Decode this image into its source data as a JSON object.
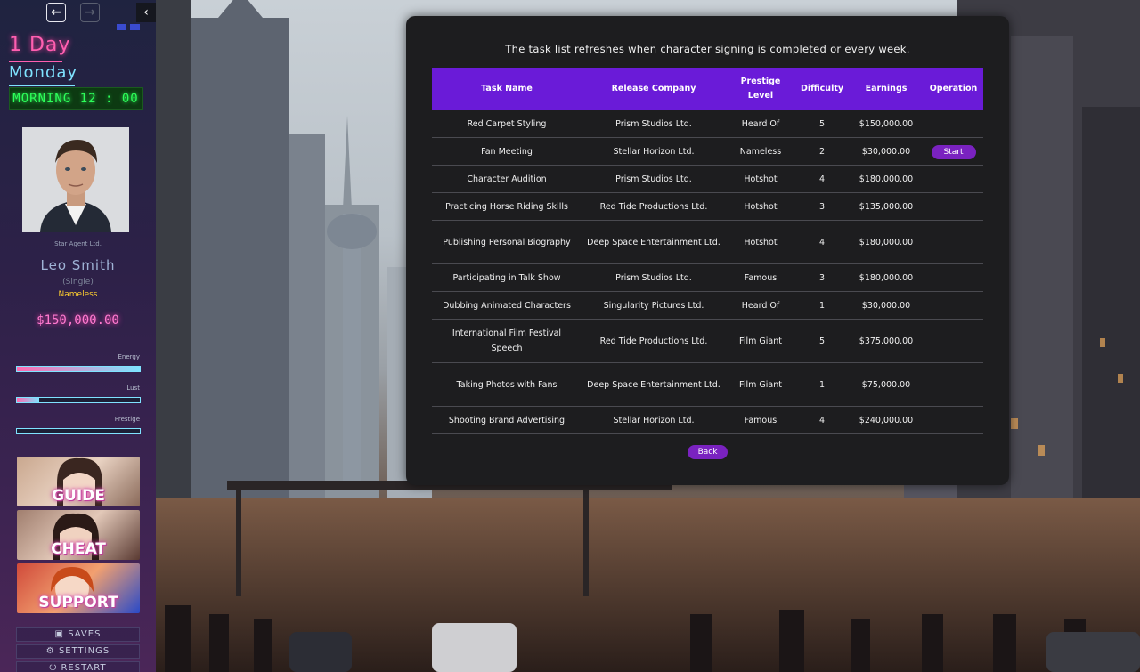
{
  "sidebar": {
    "day": "1 Day",
    "weekday": "Monday",
    "clock": "MORNING 12 : 00",
    "agency": "Star Agent Ltd.",
    "name": "Leo Smith",
    "relationship": "(Single)",
    "rank": "Nameless",
    "money": "$150,000.00",
    "stats": [
      {
        "label": "Energy",
        "value": 1.0
      },
      {
        "label": "Lust",
        "value": 0.18
      },
      {
        "label": "Prestige",
        "value": 0.0
      }
    ],
    "promos": [
      "GUIDE",
      "CHEAT",
      "SUPPORT"
    ],
    "menu": [
      {
        "icon": "save-icon",
        "label": "SAVES"
      },
      {
        "icon": "gear-icon",
        "label": "SETTINGS"
      },
      {
        "icon": "power-icon",
        "label": "RESTART"
      }
    ]
  },
  "panel": {
    "notice": "The task list refreshes when character signing is completed or every week.",
    "headers": [
      "Task Name",
      "Release Company",
      "Prestige Level",
      "Difficulty",
      "Earnings",
      "Operation"
    ],
    "rows": [
      {
        "task": "Red Carpet Styling",
        "company": "Prism Studios Ltd.",
        "level": "Heard Of",
        "difficulty": "5",
        "earnings": "$150,000.00",
        "operation": ""
      },
      {
        "task": "Fan Meeting",
        "company": "Stellar Horizon Ltd.",
        "level": "Nameless",
        "difficulty": "2",
        "earnings": "$30,000.00",
        "operation": "Start"
      },
      {
        "task": "Character Audition",
        "company": "Prism Studios Ltd.",
        "level": "Hotshot",
        "difficulty": "4",
        "earnings": "$180,000.00",
        "operation": ""
      },
      {
        "task": "Practicing Horse Riding Skills",
        "company": "Red Tide Productions Ltd.",
        "level": "Hotshot",
        "difficulty": "3",
        "earnings": "$135,000.00",
        "operation": ""
      },
      {
        "task": "Publishing Personal Biography",
        "company": "Deep Space Entertainment Ltd.",
        "level": "Hotshot",
        "difficulty": "4",
        "earnings": "$180,000.00",
        "operation": ""
      },
      {
        "task": "Participating in Talk Show",
        "company": "Prism Studios Ltd.",
        "level": "Famous",
        "difficulty": "3",
        "earnings": "$180,000.00",
        "operation": ""
      },
      {
        "task": "Dubbing Animated Characters",
        "company": "Singularity Pictures Ltd.",
        "level": "Heard Of",
        "difficulty": "1",
        "earnings": "$30,000.00",
        "operation": ""
      },
      {
        "task": "International Film Festival Speech",
        "company": "Red Tide Productions Ltd.",
        "level": "Film Giant",
        "difficulty": "5",
        "earnings": "$375,000.00",
        "operation": ""
      },
      {
        "task": "Taking Photos with Fans",
        "company": "Deep Space Entertainment Ltd.",
        "level": "Film Giant",
        "difficulty": "1",
        "earnings": "$75,000.00",
        "operation": ""
      },
      {
        "task": "Shooting Brand Advertising",
        "company": "Stellar Horizon Ltd.",
        "level": "Famous",
        "difficulty": "4",
        "earnings": "$240,000.00",
        "operation": ""
      }
    ],
    "back": "Back"
  },
  "colors": {
    "header_purple": "#6a1bd8",
    "button_purple": "#7a22c0",
    "money_pink": "#ff7ad0",
    "clock_green": "#2dff5a",
    "rank_yellow": "#ffcf2e"
  }
}
